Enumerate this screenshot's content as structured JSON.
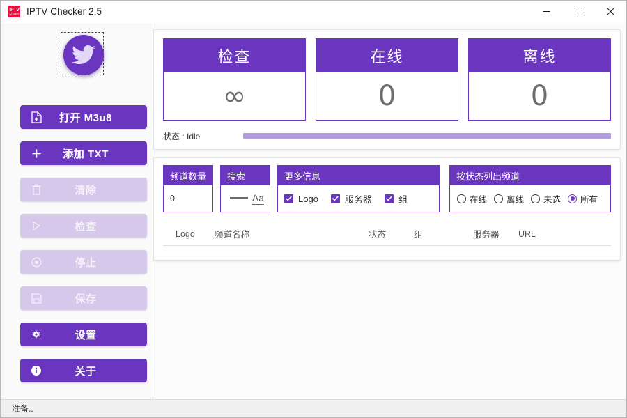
{
  "window": {
    "title": "IPTV Checker 2.5",
    "icon_line1": "IPTV",
    "icon_line2": "Checker",
    "minimize_label": "minimize",
    "maximize_label": "maximize",
    "close_label": "close"
  },
  "colors": {
    "accent": "#6a35bf",
    "accent_light": "#d5c8ea",
    "progress": "#b39ddb",
    "icon_red": "#e8113c"
  },
  "sidebar": {
    "logo_name": "twitter-bird-logo",
    "buttons": [
      {
        "label": "打开 M3u8",
        "icon": "file-add-icon",
        "enabled": true
      },
      {
        "label": "添加 TXT",
        "icon": "plus-icon",
        "enabled": true
      },
      {
        "label": "清除",
        "icon": "trash-icon",
        "enabled": false
      },
      {
        "label": "检查",
        "icon": "play-icon",
        "enabled": false
      },
      {
        "label": "停止",
        "icon": "stop-icon",
        "enabled": false
      },
      {
        "label": "保存",
        "icon": "save-icon",
        "enabled": false
      },
      {
        "label": "设置",
        "icon": "gear-icon",
        "enabled": true
      },
      {
        "label": "关于",
        "icon": "info-icon",
        "enabled": true
      }
    ]
  },
  "stats": [
    {
      "title": "检查",
      "value": "∞"
    },
    {
      "title": "在线",
      "value": "0"
    },
    {
      "title": "离线",
      "value": "0"
    }
  ],
  "status": {
    "label": "状态 : Idle",
    "progress_percent": 100
  },
  "filters": {
    "count": {
      "title": "频道数量",
      "value": "0"
    },
    "search": {
      "title": "搜索",
      "value": "",
      "icon": "text-case-icon",
      "icon_text": "Aa"
    },
    "more_info": {
      "title": "更多信息",
      "options": [
        {
          "label": "Logo",
          "checked": true
        },
        {
          "label": "服务器",
          "checked": true
        },
        {
          "label": "组",
          "checked": true
        }
      ]
    },
    "status_filter": {
      "title": "按状态列出频道",
      "options": [
        {
          "label": "在线",
          "selected": false
        },
        {
          "label": "离线",
          "selected": false
        },
        {
          "label": "未选",
          "selected": false
        },
        {
          "label": "所有",
          "selected": true
        }
      ]
    }
  },
  "table": {
    "columns": [
      "Logo",
      "频道名称",
      "状态",
      "组",
      "服务器",
      "URL"
    ],
    "rows": []
  },
  "statusbar": {
    "text": "准备.."
  }
}
